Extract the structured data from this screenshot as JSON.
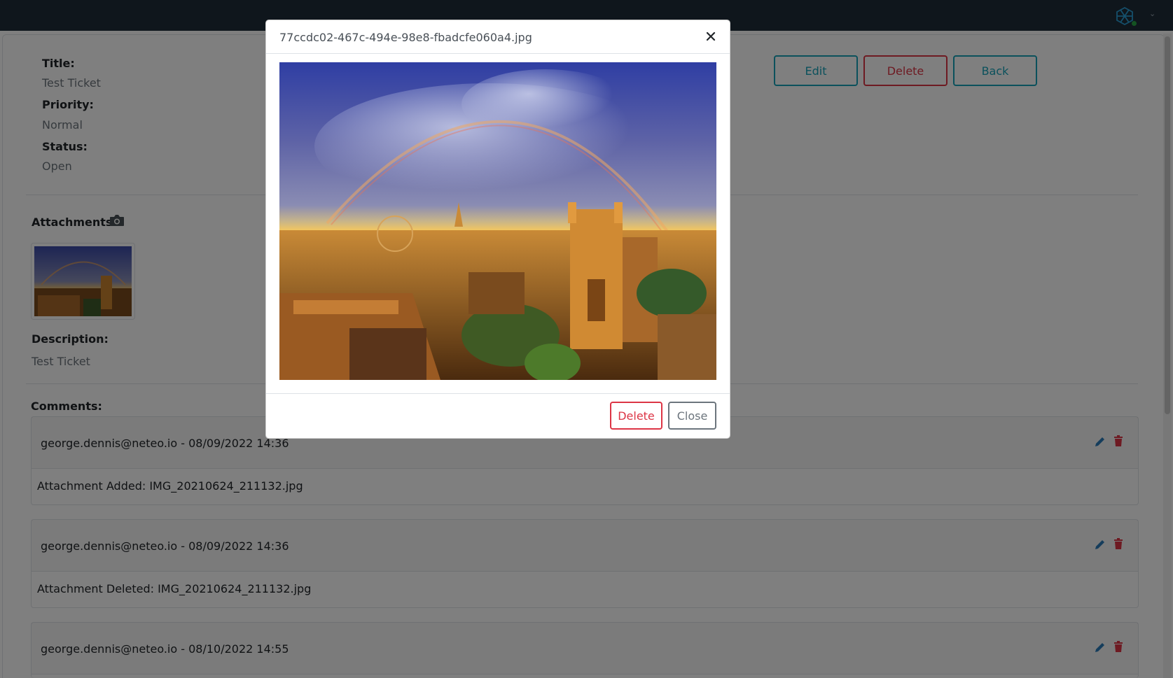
{
  "colors": {
    "topbar": "#1e2d39",
    "info": "#17a2b8",
    "danger": "#dc3545",
    "muted": "#6c757d",
    "online": "#28a745"
  },
  "ticket": {
    "title_label": "Title:",
    "title_value": "Test Ticket",
    "priority_label": "Priority:",
    "priority_value": "Normal",
    "status_label": "Status:",
    "status_value": "Open",
    "attachments_label": "Attachments:",
    "description_label": "Description:",
    "description_value": "Test Ticket",
    "comments_label": "Comments:"
  },
  "actions": {
    "edit": "Edit",
    "delete": "Delete",
    "back": "Back"
  },
  "comments": [
    {
      "author": "george.dennis@neteo.io - 08/09/2022 14:36",
      "text": "Attachment Added: IMG_20210624_211132.jpg"
    },
    {
      "author": "george.dennis@neteo.io - 08/09/2022 14:36",
      "text": "Attachment Deleted: IMG_20210624_211132.jpg"
    },
    {
      "author": "george.dennis@neteo.io - 08/10/2022 14:55",
      "text": ""
    }
  ],
  "modal": {
    "title": "77ccdc02-467c-494e-98e8-fbadcfe060a4.jpg",
    "delete_label": "Delete",
    "close_label": "Close"
  },
  "icons": {
    "brand": "cube-logo-icon",
    "camera": "camera-icon",
    "edit": "pencil-icon",
    "delete": "trash-icon",
    "close": "close-icon"
  }
}
